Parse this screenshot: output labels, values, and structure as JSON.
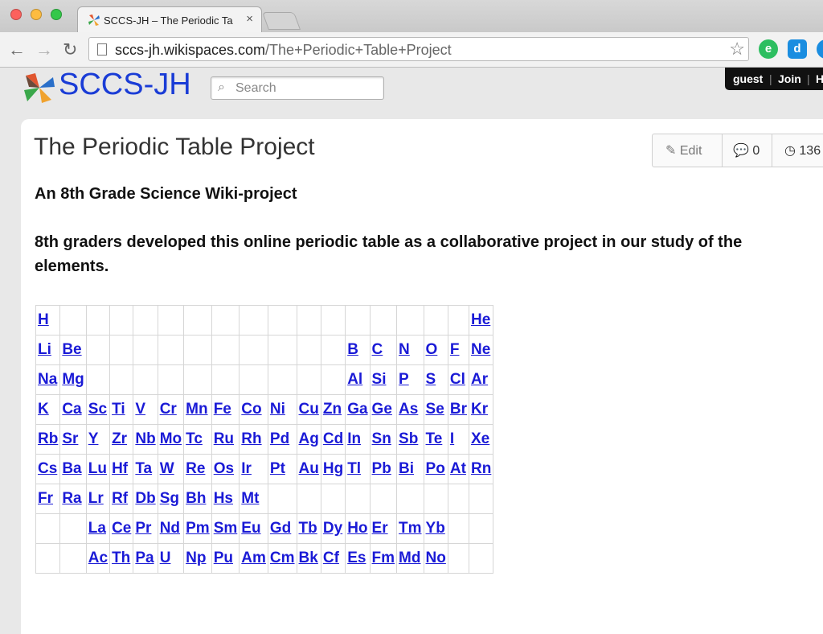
{
  "browser": {
    "tab_title": "SCCS-JH – The Periodic Ta",
    "url_host": "sccs-jh.wikispaces.com",
    "url_path": "/The+Periodic+Table+Project"
  },
  "site": {
    "name": "SCCS-JH",
    "search_placeholder": "Search",
    "user": {
      "guest": "guest",
      "join": "Join",
      "help": "H"
    }
  },
  "page": {
    "title": "The Periodic Table Project",
    "actions": {
      "edit": "Edit",
      "comments": "0",
      "history": "136"
    },
    "subtitle": "An 8th Grade Science Wiki-project",
    "description": "8th graders developed this online periodic table as a collaborative project in our study of the elements."
  },
  "periodic_table": {
    "columns": 18,
    "rows": [
      [
        "H",
        "",
        "",
        "",
        "",
        "",
        "",
        "",
        "",
        "",
        "",
        "",
        "",
        "",
        "",
        "",
        "",
        "He"
      ],
      [
        "Li",
        "Be",
        "",
        "",
        "",
        "",
        "",
        "",
        "",
        "",
        "",
        "",
        "B",
        "C",
        "N",
        "O",
        "F",
        "Ne"
      ],
      [
        "Na",
        "Mg",
        "",
        "",
        "",
        "",
        "",
        "",
        "",
        "",
        "",
        "",
        "Al",
        "Si",
        "P",
        "S",
        "Cl",
        "Ar"
      ],
      [
        "K",
        "Ca",
        "Sc",
        "Ti",
        "V",
        "Cr",
        "Mn",
        "Fe",
        "Co",
        "Ni",
        "Cu",
        "Zn",
        "Ga",
        "Ge",
        "As",
        "Se",
        "Br",
        "Kr"
      ],
      [
        "Rb",
        "Sr",
        "Y",
        "Zr",
        "Nb",
        "Mo",
        "Tc",
        "Ru",
        "Rh",
        "Pd",
        "Ag",
        "Cd",
        "In",
        "Sn",
        "Sb",
        "Te",
        "I",
        "Xe"
      ],
      [
        "Cs",
        "Ba",
        "Lu",
        "Hf",
        "Ta",
        "W",
        "Re",
        "Os",
        "Ir",
        "Pt",
        "Au",
        "Hg",
        "Tl",
        "Pb",
        "Bi",
        "Po",
        "At",
        "Rn"
      ],
      [
        "Fr",
        "Ra",
        "Lr",
        "Rf",
        "Db",
        "Sg",
        "Bh",
        "Hs",
        "Mt",
        "",
        "",
        "",
        "",
        "",
        "",
        "",
        "",
        ""
      ],
      [
        "",
        "",
        "La",
        "Ce",
        "Pr",
        "Nd",
        "Pm",
        "Sm",
        "Eu",
        "Gd",
        "Tb",
        "Dy",
        "Ho",
        "Er",
        "Tm",
        "Yb",
        "",
        ""
      ],
      [
        "",
        "",
        "Ac",
        "Th",
        "Pa",
        "U",
        "Np",
        "Pu",
        "Am",
        "Cm",
        "Bk",
        "Cf",
        "Es",
        "Fm",
        "Md",
        "No",
        "",
        ""
      ]
    ]
  }
}
